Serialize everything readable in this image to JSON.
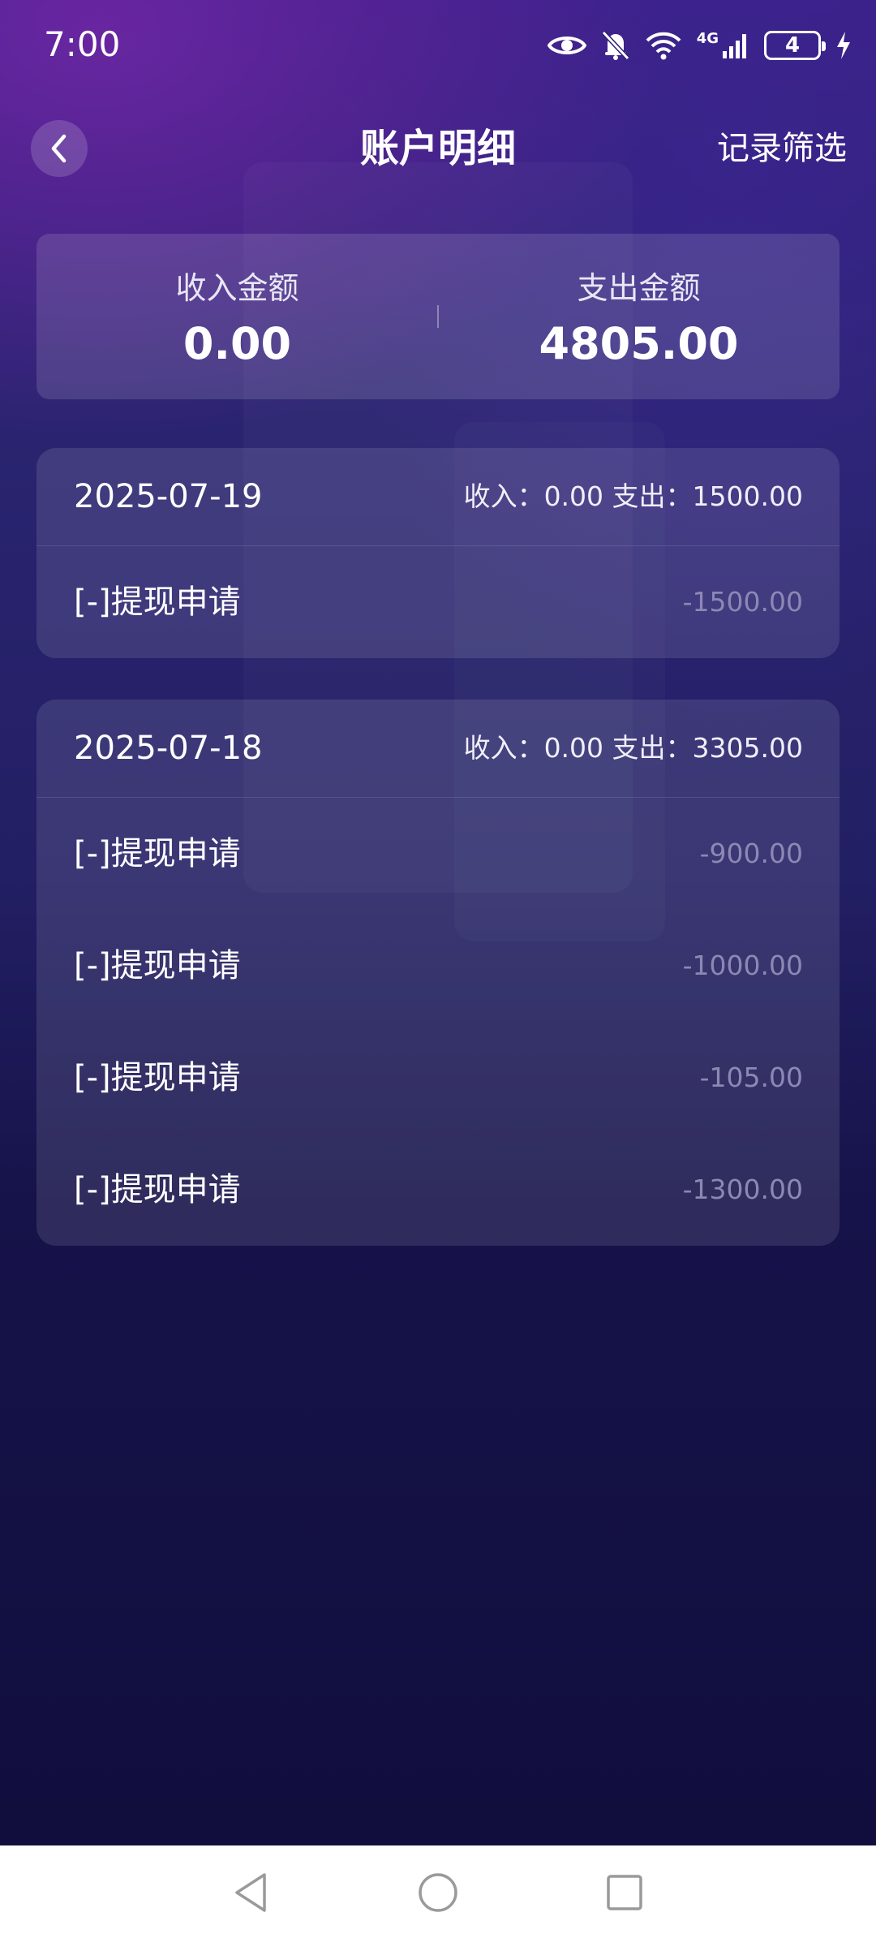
{
  "status_bar": {
    "time": "7:00",
    "network": "4G",
    "battery": "4",
    "icons": [
      "eye-icon",
      "bell-muted-icon",
      "wifi-icon",
      "signal-icon",
      "battery-icon",
      "charging-icon"
    ]
  },
  "header": {
    "back_icon": "chevron-left-icon",
    "title": "账户明细",
    "filter_label": "记录筛选"
  },
  "summary": {
    "income_label": "收入金额",
    "income_value": "0.00",
    "expense_label": "支出金额",
    "expense_value": "4805.00"
  },
  "days": [
    {
      "date": "2025-07-19",
      "totals": "收入：0.00 支出：1500.00",
      "items": [
        {
          "title": "[-]提现申请",
          "amount": "-1500.00"
        }
      ]
    },
    {
      "date": "2025-07-18",
      "totals": "收入：0.00 支出：3305.00",
      "items": [
        {
          "title": "[-]提现申请",
          "amount": "-900.00"
        },
        {
          "title": "[-]提现申请",
          "amount": "-1000.00"
        },
        {
          "title": "[-]提现申请",
          "amount": "-105.00"
        },
        {
          "title": "[-]提现申请",
          "amount": "-1300.00"
        }
      ]
    }
  ],
  "nav_bar": {
    "icons": [
      "back-triangle-icon",
      "home-circle-icon",
      "recents-square-icon"
    ]
  },
  "colors": {
    "background_top": "#3b1f86",
    "background_bottom": "#100d3c",
    "amount_muted": "#8c88b4",
    "nav_bar": "#ffffff"
  }
}
